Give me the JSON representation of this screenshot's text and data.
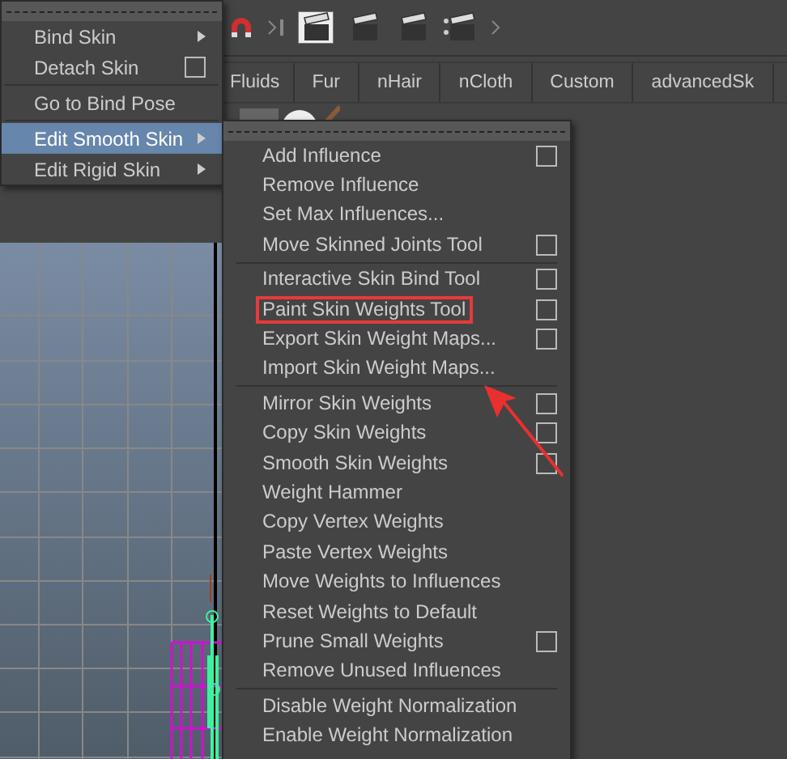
{
  "shelf_tabs": [
    {
      "label": "Fluids"
    },
    {
      "label": "Fur"
    },
    {
      "label": "nHair"
    },
    {
      "label": "nCloth"
    },
    {
      "label": "Custom"
    },
    {
      "label": "advancedSk"
    }
  ],
  "skin_menu": {
    "sections": [
      {
        "items": [
          {
            "label": "Bind Skin",
            "kind": "submenu",
            "selected": false
          },
          {
            "label": "Detach Skin",
            "kind": "option",
            "selected": false
          }
        ]
      },
      {
        "items": [
          {
            "label": "Go to Bind Pose",
            "kind": "plain",
            "selected": false
          }
        ]
      },
      {
        "items": [
          {
            "label": "Edit Smooth Skin",
            "kind": "submenu",
            "selected": true
          },
          {
            "label": "Edit Rigid Skin",
            "kind": "submenu",
            "selected": false
          }
        ]
      }
    ]
  },
  "smooth_skin_menu": {
    "sections": [
      {
        "items": [
          {
            "label": "Add Influence",
            "option_box": true,
            "highlighted": false
          },
          {
            "label": "Remove Influence",
            "option_box": false,
            "highlighted": false
          },
          {
            "label": "Set Max Influences...",
            "option_box": false,
            "highlighted": false
          },
          {
            "label": "Move Skinned Joints Tool",
            "option_box": true,
            "highlighted": false
          }
        ]
      },
      {
        "items": [
          {
            "label": "Interactive Skin Bind Tool",
            "option_box": true,
            "highlighted": false
          },
          {
            "label": "Paint Skin Weights Tool",
            "option_box": true,
            "highlighted": true
          },
          {
            "label": "Export Skin Weight Maps...",
            "option_box": true,
            "highlighted": false
          },
          {
            "label": "Import Skin Weight Maps...",
            "option_box": false,
            "highlighted": false
          }
        ]
      },
      {
        "items": [
          {
            "label": "Mirror Skin Weights",
            "option_box": true,
            "highlighted": false
          },
          {
            "label": "Copy Skin Weights",
            "option_box": true,
            "highlighted": false
          },
          {
            "label": "Smooth Skin Weights",
            "option_box": true,
            "highlighted": false
          },
          {
            "label": "Weight Hammer",
            "option_box": false,
            "highlighted": false
          },
          {
            "label": "Copy Vertex Weights",
            "option_box": false,
            "highlighted": false
          },
          {
            "label": "Paste Vertex Weights",
            "option_box": false,
            "highlighted": false
          },
          {
            "label": "Move Weights to Influences",
            "option_box": false,
            "highlighted": false
          },
          {
            "label": "Reset Weights to Default",
            "option_box": false,
            "highlighted": false
          },
          {
            "label": "Prune Small Weights",
            "option_box": true,
            "highlighted": false
          },
          {
            "label": "Remove Unused Influences",
            "option_box": false,
            "highlighted": false
          }
        ]
      },
      {
        "items": [
          {
            "label": "Disable Weight Normalization",
            "option_box": false,
            "highlighted": false
          },
          {
            "label": "Enable Weight Normalization",
            "option_box": false,
            "highlighted": false
          }
        ]
      }
    ]
  }
}
